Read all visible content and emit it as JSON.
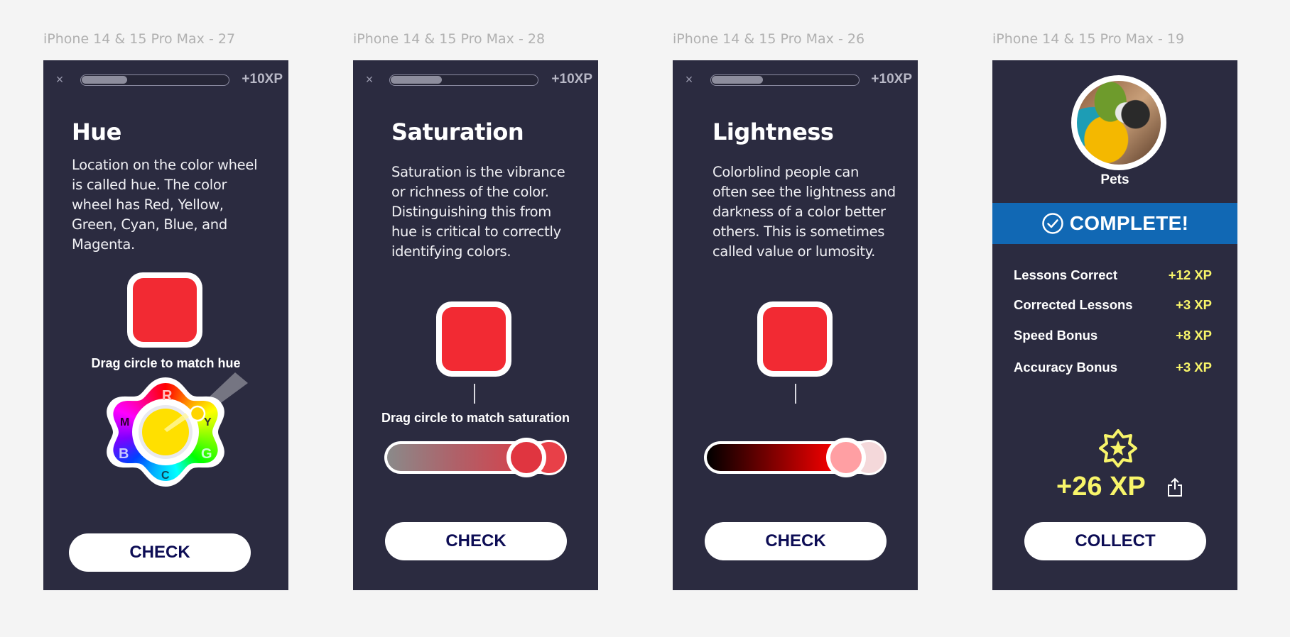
{
  "frames": [
    {
      "label": "iPhone 14 & 15 Pro Max - 27",
      "progress_percent": 31,
      "xp": "+10XP",
      "title": "Hue",
      "description": "Location on the color wheel is called hue. The color wheel has Red, Yellow, Green, Cyan, Blue, and Magenta.",
      "target_color": "#f22a33",
      "instruction": "Drag circle to match hue",
      "wheel_labels": [
        "R",
        "Y",
        "G",
        "C",
        "B",
        "M"
      ],
      "wheel_selected_color": "#ffe000",
      "button": "CHECK"
    },
    {
      "label": "iPhone 14 & 15 Pro Max - 28",
      "progress_percent": 35,
      "xp": "+10XP",
      "title": "Saturation",
      "description": "Saturation is the vibrance or richness of the color. Distinguishing this from hue is critical to correctly identifying colors.",
      "target_color": "#f22a33",
      "instruction": "Drag circle to match saturation",
      "slider_value_percent": 86,
      "slider_thumb_color": "#e03540",
      "button": "CHECK"
    },
    {
      "label": "iPhone 14 & 15 Pro Max - 26",
      "progress_percent": 35,
      "xp": "+10XP",
      "title": "Lightness",
      "description": "Colorblind people can often see the lightness and darkness of a color better others. This is sometimes called value or lumosity.",
      "target_color": "#f22a33",
      "slider_value_percent": 86,
      "slider_thumb_color": "#ff9fa3",
      "button": "CHECK"
    },
    {
      "label": "iPhone 14 & 15 Pro Max - 19",
      "category": "Pets",
      "complete_text": "COMPLETE!",
      "bonuses": [
        {
          "label": "Lessons Correct",
          "value": "+12 XP"
        },
        {
          "label": "Corrected Lessons",
          "value": "+3 XP"
        },
        {
          "label": "Speed Bonus",
          "value": "+8 XP"
        },
        {
          "label": "Accuracy Bonus",
          "value": "+3 XP"
        }
      ],
      "total_xp": "+26 XP",
      "button": "COLLECT"
    }
  ],
  "icons": {
    "close": "×"
  },
  "colors": {
    "background": "#f4f4f4",
    "phone_bg": "#2b2b40",
    "banner_blue": "#1168b4",
    "xp_yellow": "#f8f56a",
    "button_text": "#0d0d55"
  }
}
